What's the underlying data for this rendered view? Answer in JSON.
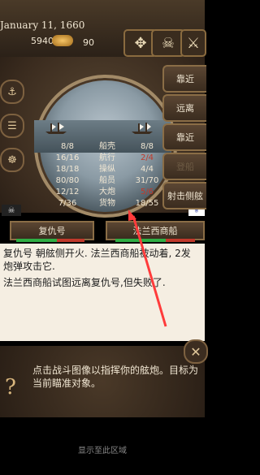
{
  "topbar": {
    "date": "January 11, 1660",
    "gold": "5940",
    "supplies": "90",
    "compass_icon": "compass-icon",
    "skull_icon": "skull-icon"
  },
  "stats": {
    "rows": [
      {
        "left": "8/8",
        "label": "船壳",
        "right": "8/8",
        "right_color": ""
      },
      {
        "left": "16/16",
        "label": "航行",
        "right": "2/4",
        "right_color": "#c0392b"
      },
      {
        "left": "18/18",
        "label": "操纵",
        "right": "4/4",
        "right_color": ""
      },
      {
        "left": "80/80",
        "label": "船员",
        "right": "31/70",
        "right_color": ""
      },
      {
        "left": "12/12",
        "label": "大炮",
        "right": "5/6",
        "right_color": "#c0392b"
      },
      {
        "left": "7/36",
        "label": "货物",
        "right": "18/55",
        "right_color": ""
      }
    ]
  },
  "right_buttons": {
    "approach1": "靠近",
    "away": "远离",
    "approach2": "靠近",
    "board": "登船",
    "broadside": "射击侧舷"
  },
  "names": {
    "left": "复仇号",
    "right": "法兰西商船"
  },
  "health": {
    "left": 0.6,
    "right": 0.63
  },
  "log": {
    "line1": "复仇号 朝舷侧开火. 法兰西商船被动着, 2发炮弹攻击它.",
    "line2": "法兰西商船试图远离复仇号,但失败了."
  },
  "hint": {
    "text": "点击战斗图像以指挥你的舷炮。目标为当前瞄准对象。"
  },
  "footer": {
    "text": "显示至此区域"
  },
  "colors": {
    "accent": "#8a6d46",
    "health_good": "#2fae44",
    "health_bad": "#c0392b"
  }
}
